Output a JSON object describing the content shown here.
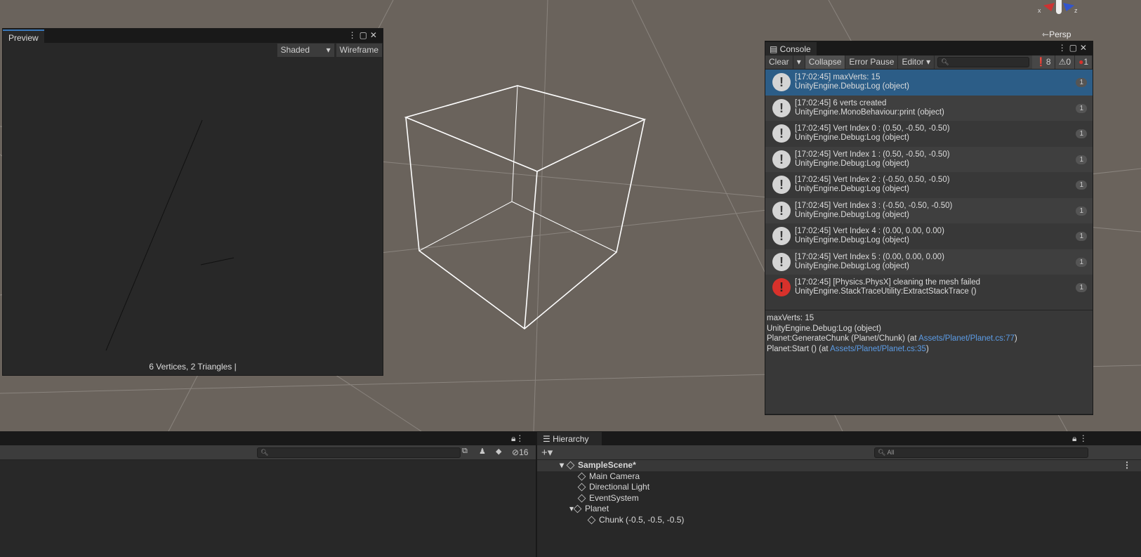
{
  "scene": {
    "gizmo_x": "x",
    "gizmo_z": "z",
    "persp_label": "Persp"
  },
  "preview": {
    "tab": "Preview",
    "shading": "Shaded",
    "wireframe": "Wireframe",
    "stats": "6 Vertices, 2 Triangles"
  },
  "console": {
    "tab": "Console",
    "clear": "Clear",
    "collapse": "Collapse",
    "error_pause": "Error Pause",
    "editor": "Editor",
    "count_info": "8",
    "count_warn": "0",
    "count_error": "1",
    "entries": [
      {
        "line1": "[17:02:45] maxVerts: 15",
        "line2": "UnityEngine.Debug:Log (object)",
        "count": "1",
        "type": "info"
      },
      {
        "line1": "[17:02:45] 6 verts created",
        "line2": "UnityEngine.MonoBehaviour:print (object)",
        "count": "1",
        "type": "info"
      },
      {
        "line1": "[17:02:45] Vert Index 0 : (0.50, -0.50, -0.50)",
        "line2": "UnityEngine.Debug:Log (object)",
        "count": "1",
        "type": "info"
      },
      {
        "line1": "[17:02:45] Vert Index 1 : (0.50, -0.50, -0.50)",
        "line2": "UnityEngine.Debug:Log (object)",
        "count": "1",
        "type": "info"
      },
      {
        "line1": "[17:02:45] Vert Index 2 : (-0.50, 0.50, -0.50)",
        "line2": "UnityEngine.Debug:Log (object)",
        "count": "1",
        "type": "info"
      },
      {
        "line1": "[17:02:45] Vert Index 3 : (-0.50, -0.50, -0.50)",
        "line2": "UnityEngine.Debug:Log (object)",
        "count": "1",
        "type": "info"
      },
      {
        "line1": "[17:02:45] Vert Index 4 : (0.00, 0.00, 0.00)",
        "line2": "UnityEngine.Debug:Log (object)",
        "count": "1",
        "type": "info"
      },
      {
        "line1": "[17:02:45] Vert Index 5 : (0.00, 0.00, 0.00)",
        "line2": "UnityEngine.Debug:Log (object)",
        "count": "1",
        "type": "info"
      },
      {
        "line1": "[17:02:45] [Physics.PhysX] cleaning the mesh failed",
        "line2": "UnityEngine.StackTraceUtility:ExtractStackTrace ()",
        "count": "1",
        "type": "error"
      }
    ],
    "detail": {
      "l1": "maxVerts: 15",
      "l2": "UnityEngine.Debug:Log (object)",
      "l3a": "Planet:GenerateChunk (Planet/Chunk) (at ",
      "l3link": "Assets/Planet/Planet.cs:77",
      "l3b": ")",
      "l4a": "Planet:Start () (at ",
      "l4link": "Assets/Planet/Planet.cs:35",
      "l4b": ")"
    }
  },
  "project": {
    "hidden_count": "16"
  },
  "hierarchy": {
    "tab": "Hierarchy",
    "search_placeholder": "All",
    "scene": "SampleScene*",
    "items": [
      "Main Camera",
      "Directional Light",
      "EventSystem",
      "Planet",
      "Chunk (-0.5, -0.5, -0.5)"
    ]
  }
}
